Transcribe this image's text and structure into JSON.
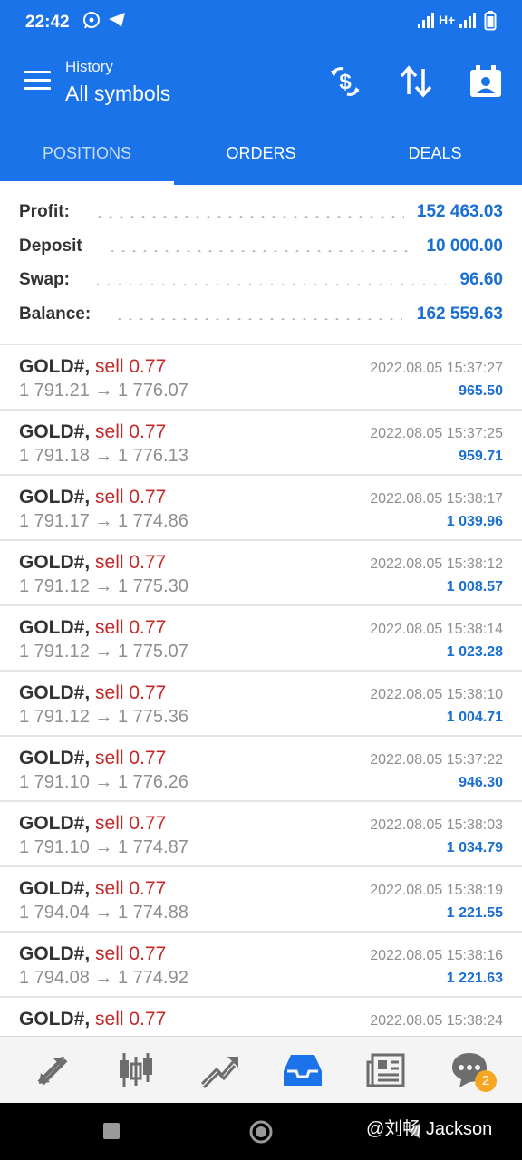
{
  "status_bar": {
    "time": "22:42",
    "network": "H+",
    "icons": [
      "whatsapp-icon",
      "telegram-icon",
      "signal-icon",
      "battery-icon"
    ]
  },
  "header": {
    "subtitle": "History",
    "title": "All symbols",
    "actions": [
      "currency-exchange-icon",
      "sort-icon",
      "calendar-icon"
    ]
  },
  "tabs": [
    {
      "label": "POSITIONS",
      "active": true
    },
    {
      "label": "ORDERS",
      "active": false
    },
    {
      "label": "DEALS",
      "active": false
    }
  ],
  "summary": [
    {
      "label": "Profit:",
      "value": "152 463.03"
    },
    {
      "label": "Deposit",
      "value": "10 000.00"
    },
    {
      "label": "Swap:",
      "value": "96.60"
    },
    {
      "label": "Balance:",
      "value": "162 559.63"
    }
  ],
  "positions": [
    {
      "symbol": "GOLD#,",
      "side": "sell 0.77",
      "prices": "1 791.21 → 1 776.07",
      "datetime": "2022.08.05 15:37:27",
      "profit": "965.50"
    },
    {
      "symbol": "GOLD#,",
      "side": "sell 0.77",
      "prices": "1 791.18 → 1 776.13",
      "datetime": "2022.08.05 15:37:25",
      "profit": "959.71"
    },
    {
      "symbol": "GOLD#,",
      "side": "sell 0.77",
      "prices": "1 791.17 → 1 774.86",
      "datetime": "2022.08.05 15:38:17",
      "profit": "1 039.96"
    },
    {
      "symbol": "GOLD#,",
      "side": "sell 0.77",
      "prices": "1 791.12 → 1 775.30",
      "datetime": "2022.08.05 15:38:12",
      "profit": "1 008.57"
    },
    {
      "symbol": "GOLD#,",
      "side": "sell 0.77",
      "prices": "1 791.12 → 1 775.07",
      "datetime": "2022.08.05 15:38:14",
      "profit": "1 023.28"
    },
    {
      "symbol": "GOLD#,",
      "side": "sell 0.77",
      "prices": "1 791.12 → 1 775.36",
      "datetime": "2022.08.05 15:38:10",
      "profit": "1 004.71"
    },
    {
      "symbol": "GOLD#,",
      "side": "sell 0.77",
      "prices": "1 791.10 → 1 776.26",
      "datetime": "2022.08.05 15:37:22",
      "profit": "946.30"
    },
    {
      "symbol": "GOLD#,",
      "side": "sell 0.77",
      "prices": "1 791.10 → 1 774.87",
      "datetime": "2022.08.05 15:38:03",
      "profit": "1 034.79"
    },
    {
      "symbol": "GOLD#,",
      "side": "sell 0.77",
      "prices": "1 794.04 → 1 774.88",
      "datetime": "2022.08.05 15:38:19",
      "profit": "1 221.55"
    },
    {
      "symbol": "GOLD#,",
      "side": "sell 0.77",
      "prices": "1 794.08 → 1 774.92",
      "datetime": "2022.08.05 15:38:16",
      "profit": "1 221.63"
    },
    {
      "symbol": "GOLD#,",
      "side": "sell 0.77",
      "prices": "",
      "datetime": "2022.08.05 15:38:24",
      "profit": ""
    }
  ],
  "bottom_nav": {
    "items": [
      "quotes-icon",
      "chart-icon",
      "trade-icon",
      "history-icon",
      "news-icon",
      "chat-icon"
    ],
    "active": "history-icon",
    "chat_badge": "2"
  },
  "system_nav": [
    "recents-button",
    "home-button",
    "back-button"
  ],
  "watermark": "@刘畅 Jackson",
  "colors": {
    "primary": "#1a73e8",
    "value_blue": "#1a6fd1",
    "sell_red": "#c62828",
    "badge": "#f5a623"
  }
}
